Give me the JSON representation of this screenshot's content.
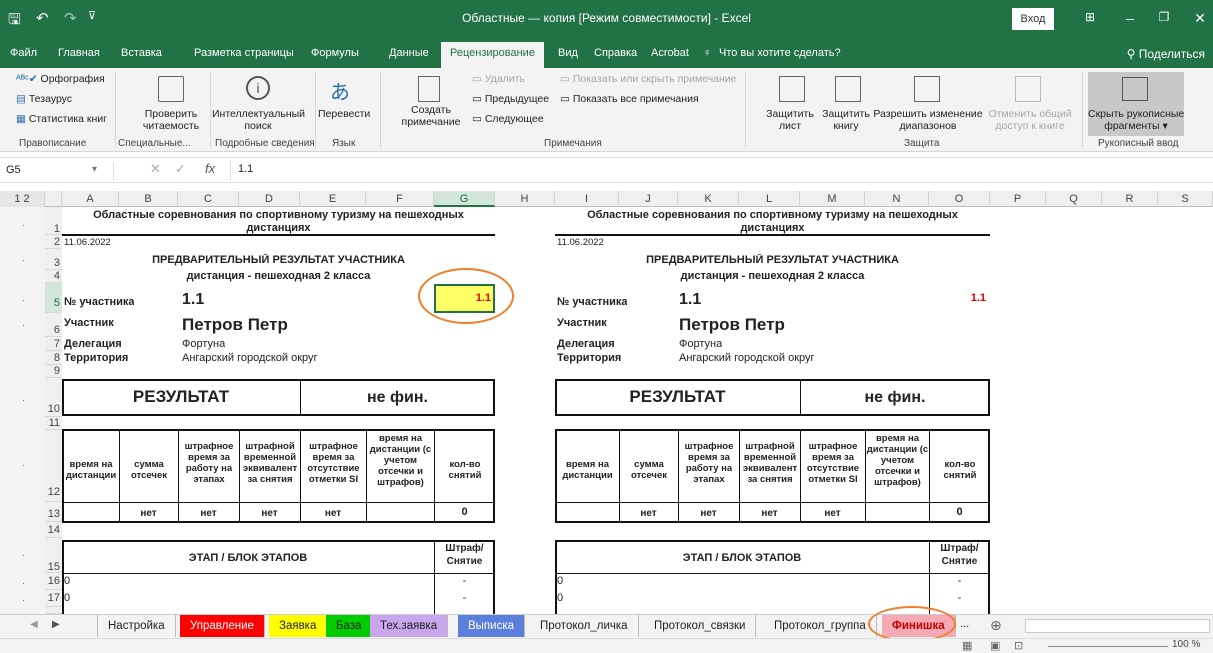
{
  "window": {
    "title": "Областные — копия [Режим совместимости] - Excel",
    "signin": "Вход",
    "share": "Поделиться"
  },
  "ribbon_tabs": [
    "Файл",
    "Главная",
    "Вставка",
    "Разметка страницы",
    "Формулы",
    "Данные",
    "Рецензирование",
    "Вид",
    "Справка",
    "Acrobat",
    "Что вы хотите сделать?"
  ],
  "ribbon": {
    "spelling": "Орфография",
    "thesaurus": "Тезаурус",
    "stats": "Статистика книг",
    "proofing": "Правописание",
    "check1": "Проверить",
    "check2": "читаемость",
    "special": "Специальные...",
    "smart1": "Интеллектуальный",
    "smart2": "поиск",
    "details": "Подробные сведения",
    "translate": "Перевести",
    "language": "Язык",
    "create1": "Создать",
    "create2": "примечание",
    "delete": "Удалить",
    "prev": "Предыдущее",
    "next": "Следующее",
    "showhide": "Показать или скрыть примечание",
    "showall": "Показать все примечания",
    "comments": "Примечания",
    "protect_sheet1": "Защитить",
    "protect_sheet2": "лист",
    "protect_book1": "Защитить",
    "protect_book2": "книгу",
    "allow1": "Разрешить изменение",
    "allow2": "диапазонов",
    "unshare1": "Отменить общий",
    "unshare2": "доступ к книге",
    "protect": "Защита",
    "hideink1": "Скрыть рукописные",
    "hideink2": "фрагменты",
    "ink": "Рукописный ввод"
  },
  "formula": {
    "name": "G5",
    "fx": "fx",
    "value": "1.1"
  },
  "columns": [
    "A",
    "B",
    "C",
    "D",
    "E",
    "F",
    "G",
    "H",
    "I",
    "J",
    "K",
    "L",
    "M",
    "N",
    "O",
    "P",
    "Q",
    "R",
    "S"
  ],
  "rows": [
    "1",
    "2",
    "3",
    "4",
    "5",
    "6",
    "7",
    "8",
    "9",
    "10",
    "11",
    "12",
    "13",
    "14",
    "15",
    "16",
    "17"
  ],
  "outline": [
    "1",
    "2"
  ],
  "sheet": {
    "title1": "Областные соревнования по спортивному туризму на пешеходных",
    "title2": "дистанциях",
    "date": "11.06.2022",
    "prelim": "ПРЕДВАРИТЕЛЬНЫЙ РЕЗУЛЬТАТ УЧАСТНИКА",
    "distance": "дистанция - пешеходная 2 класса",
    "num_label": "№ участника",
    "num": "1.1",
    "num_red": "1.1",
    "part_label": "Участник",
    "part": "Петров Петр",
    "deleg_label": "Делегация",
    "deleg": "Фортуна",
    "terr_label": "Территория",
    "terr": "Ангарский городской округ",
    "result": "РЕЗУЛЬТАТ",
    "notfin": "не фин.",
    "h1": "время на дистанции",
    "h2": "сумма отсечек",
    "h3": "штрафное время за работу на этапах",
    "h4": "штрафной временной эквивалент за снятия",
    "h5": "штрафное время за отсутствие отметки SI",
    "h6": "время на дистанции (с учетом отсечки и штрафов)",
    "h7": "кол-во снятий",
    "net": "нет",
    "zero": "0",
    "stage": "ЭТАП / БЛОК ЭТАПОВ",
    "penalty1": "Штраф/",
    "penalty2": "Снятие",
    "r16": "0",
    "r17": "0",
    "dash": "-"
  },
  "sheet_tabs": [
    {
      "label": "Настройка",
      "bg": "#ffffff"
    },
    {
      "label": "Управление",
      "bg": "#ff0000"
    },
    {
      "label": "Заявка",
      "bg": "#ffff00"
    },
    {
      "label": "База",
      "bg": "#00cc00"
    },
    {
      "label": "Тех.заявка",
      "bg": "#c8a6ee"
    },
    {
      "label": "Выписка",
      "bg": "#5b7fdc"
    },
    {
      "label": "Протокол_личка",
      "bg": "#f3f3f3"
    },
    {
      "label": "Протокол_связки",
      "bg": "#f3f3f3"
    },
    {
      "label": "Протокол_группа",
      "bg": "#f3f3f3"
    },
    {
      "label": "Финишка",
      "bg": "#f4a9b5"
    }
  ],
  "zoom": "100 %",
  "colors": {
    "excel_green": "#217346",
    "highlight": "#f07f2b"
  }
}
